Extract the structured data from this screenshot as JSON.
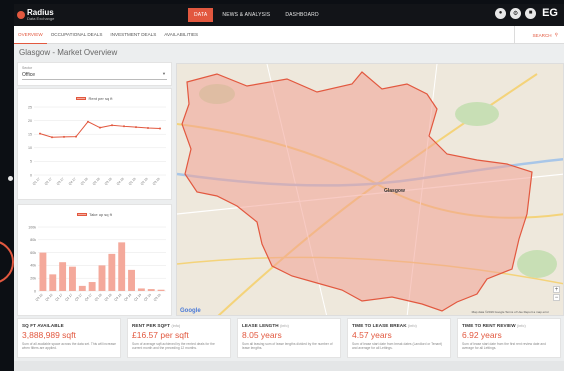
{
  "app": {
    "logo_name": "Radius",
    "logo_sub": "Data Exchange",
    "user_initials": "EG"
  },
  "top_nav": [
    {
      "label": "DATA",
      "active": true
    },
    {
      "label": "NEWS & ANALYSIS",
      "active": false
    },
    {
      "label": "DASHBOARD",
      "active": false
    }
  ],
  "sub_nav": [
    {
      "label": "OVERVIEW",
      "active": true
    },
    {
      "label": "OCCUPATIONAL DEALS",
      "active": false
    },
    {
      "label": "INVESTMENT DEALS",
      "active": false
    },
    {
      "label": "AVAILABILITIES",
      "active": false
    }
  ],
  "search_label": "SEARCH",
  "page_title": "Glasgow - Market Overview",
  "filter": {
    "label": "Sector",
    "value": "Office"
  },
  "map": {
    "city_label": "Glasgow",
    "footer": "Map data ©2019 Google   Terms of Use   Report a map error",
    "google": "Google"
  },
  "chart_data": [
    {
      "type": "line",
      "series": [
        {
          "name": "Rent per sq ft",
          "values": [
            15.2,
            13.9,
            14.0,
            14.1,
            19.6,
            17.4,
            18.3,
            17.9,
            17.6,
            17.3,
            17.1
          ]
        }
      ],
      "categories": [
        "Q1 17",
        "Q2 17",
        "Q3 17",
        "Q4 17",
        "Q1 18",
        "Q2 18",
        "Q3 18",
        "Q4 18",
        "Q1 19",
        "Q2 19",
        "Q3 19"
      ],
      "ylim": [
        0,
        25
      ],
      "yticks": [
        "25",
        "20",
        "15",
        "10",
        "5",
        "0"
      ],
      "grid": true,
      "legend": "top"
    },
    {
      "type": "bar",
      "series": [
        {
          "name": "Take up sq ft",
          "values": [
            60000,
            26000,
            45000,
            38000,
            8000,
            14000,
            40000,
            58000,
            76000,
            33000,
            4000,
            3000,
            2000
          ]
        }
      ],
      "categories": [
        "Q3 16",
        "Q4 16",
        "Q1 17",
        "Q2 17",
        "Q3 17",
        "Q4 17",
        "Q1 18",
        "Q2 18",
        "Q3 18",
        "Q4 18",
        "Q1 19",
        "Q2 19",
        "Q3 19"
      ],
      "ylim": [
        0,
        100000
      ],
      "yticks": [
        "100k",
        "80k",
        "60k",
        "40k",
        "20k",
        "0"
      ],
      "grid": true,
      "legend": "top"
    }
  ],
  "stats": [
    {
      "title": "SQ FT AVAILABLE",
      "info": "",
      "value": "3,888,989 sqft",
      "desc": "Sum of all available space across the data set. This will increase when filters are applied."
    },
    {
      "title": "RENT PER SQFT",
      "info": "(info)",
      "value": "£16.57 per sqft",
      "desc": "Sum of average sqft achieved by the rented deals for the current month and the preceding 12 months."
    },
    {
      "title": "LEASE LENGTH",
      "info": "(info)",
      "value": "8.05 years",
      "desc": "Sum all leasing sum of lease lengths divided by the number of lease lengths."
    },
    {
      "title": "TIME TO LEASE BREAK",
      "info": "(info)",
      "value": "4.57 years",
      "desc": "Sum of lease start date from break dates (Landlord or Tenant) and average for all Lettings."
    },
    {
      "title": "TIME TO RENT REVIEW",
      "info": "(info)",
      "value": "6.92 years",
      "desc": "Sum of lease start date from the first rent review date and average for all Lettings."
    }
  ]
}
